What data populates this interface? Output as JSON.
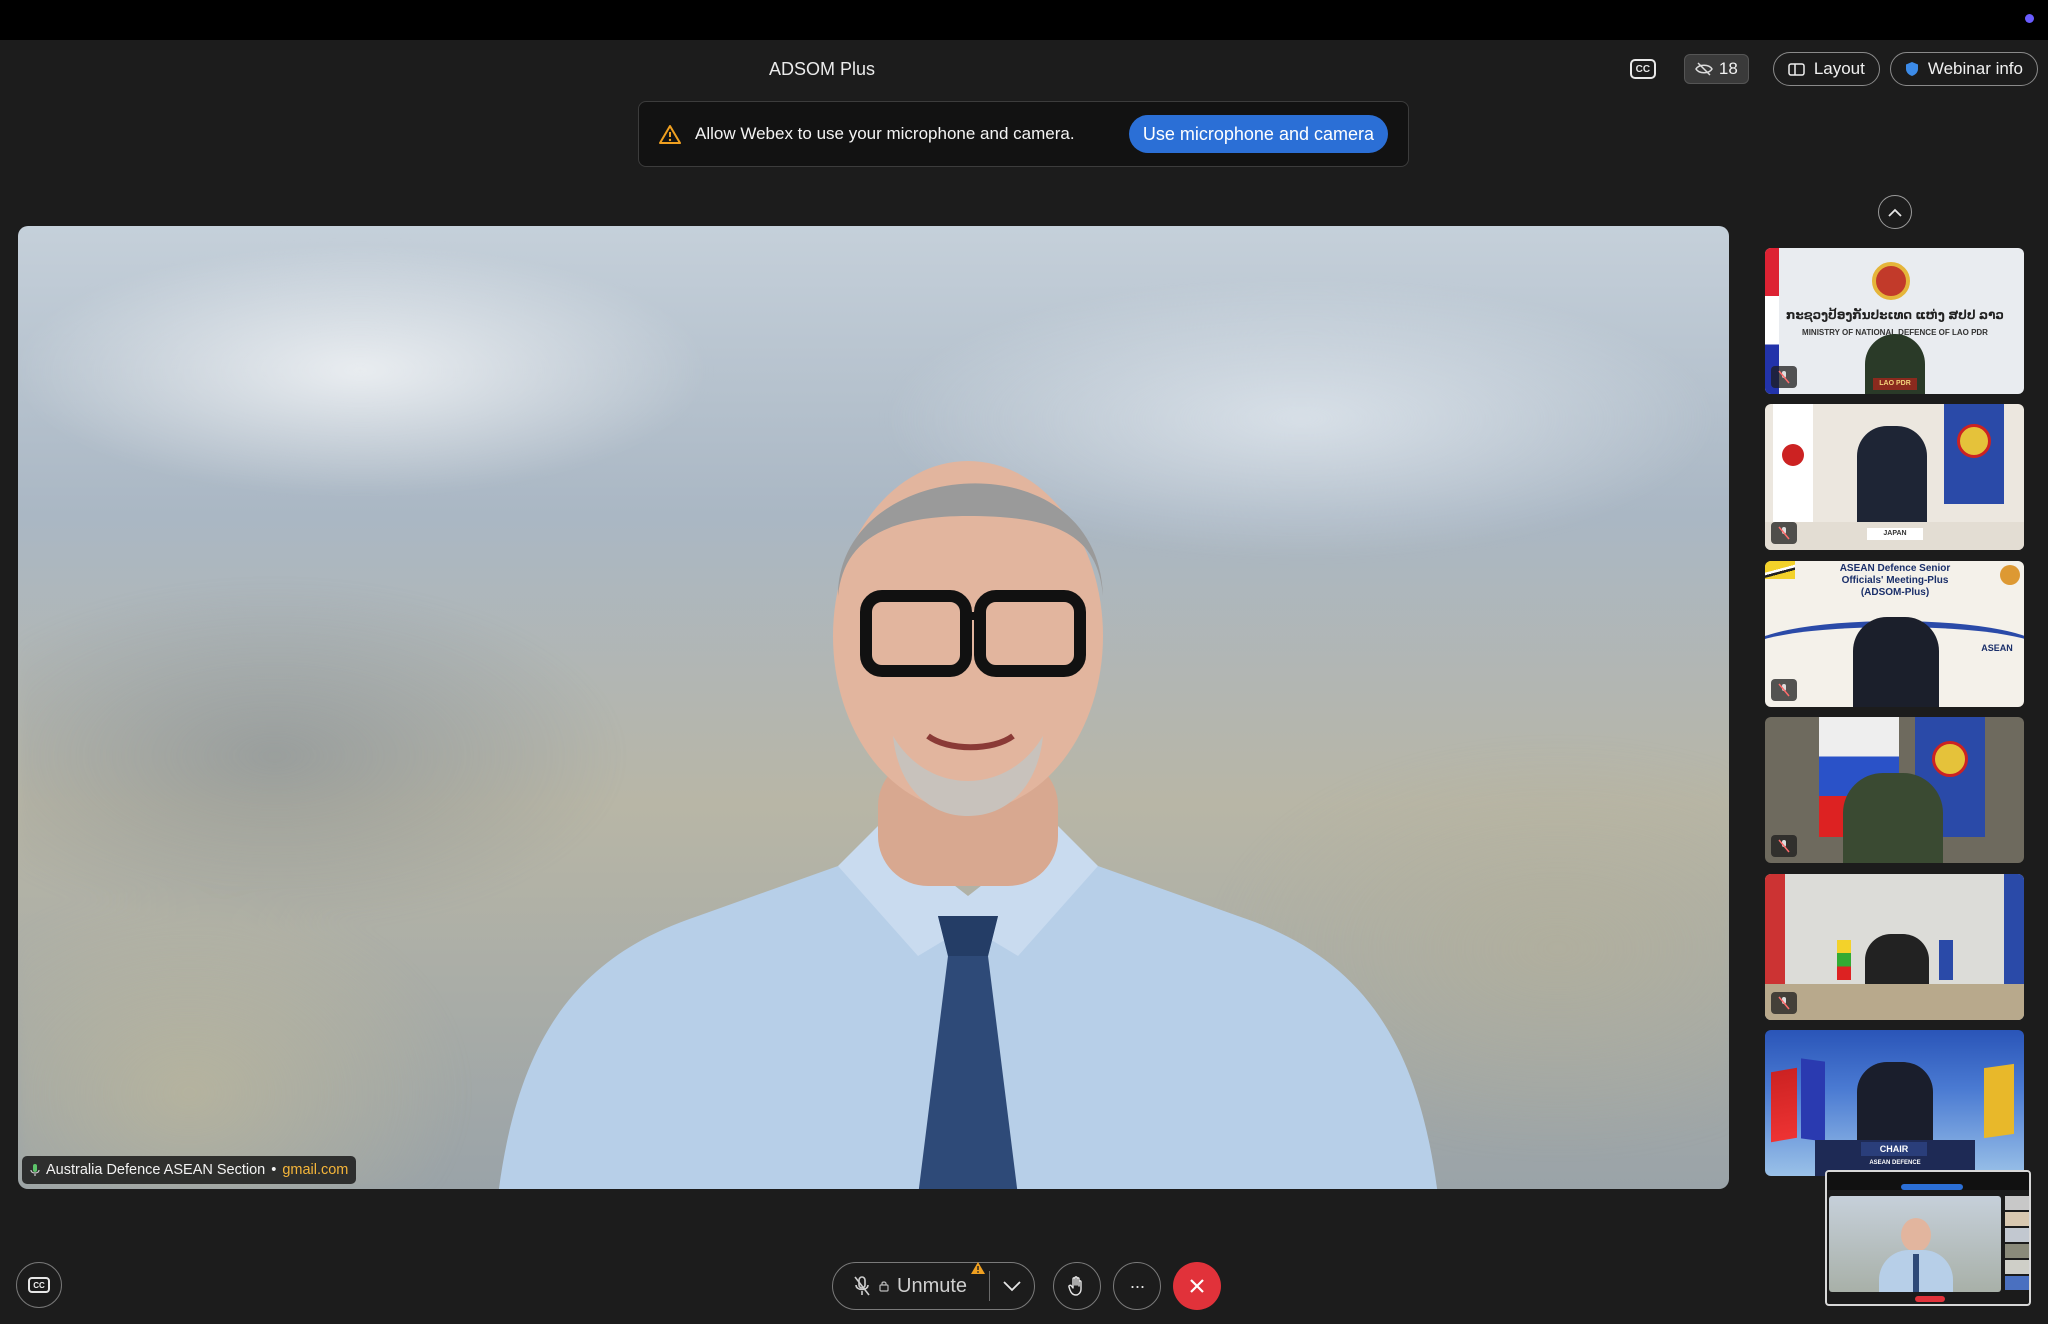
{
  "meeting": {
    "title": "ADSOM Plus"
  },
  "header": {
    "participant_count": "18",
    "layout_label": "Layout",
    "webinar_info_label": "Webinar info",
    "cc_label": "CC"
  },
  "permission_banner": {
    "message": "Allow Webex to use your microphone and camera.",
    "button_label": "Use microphone and camera"
  },
  "main_video": {
    "speaker_name": "Australia Defence ASEAN Section",
    "separator": "•",
    "email_domain": "gmail.com"
  },
  "thumbnails": [
    {
      "line1": "ກະຊວງປ້ອງກັນປະເທດ ແຫ່ງ ສປປ ລາວ",
      "line2": "MINISTRY OF NATIONAL DEFENCE OF LAO PDR",
      "nameplate": "LAO PDR"
    },
    {
      "nameplate": "JAPAN"
    },
    {
      "line1": "ASEAN Defence Senior",
      "line2": "Officials' Meeting-Plus",
      "line3": "(ADSOM-Plus)",
      "logo": "ASEAN"
    },
    {},
    {},
    {
      "nameplate": "CHAIR",
      "line1": "ASEAN DEFENCE"
    }
  ],
  "controls": {
    "unmute_label": "Unmute",
    "cc_label": "CC",
    "more_label": "···"
  },
  "colors": {
    "background": "#1c1c1c",
    "primary_button": "#2b6fd6",
    "leave_button": "#e1323a",
    "email_accent": "#f5b53a",
    "warning": "#f0a020"
  }
}
